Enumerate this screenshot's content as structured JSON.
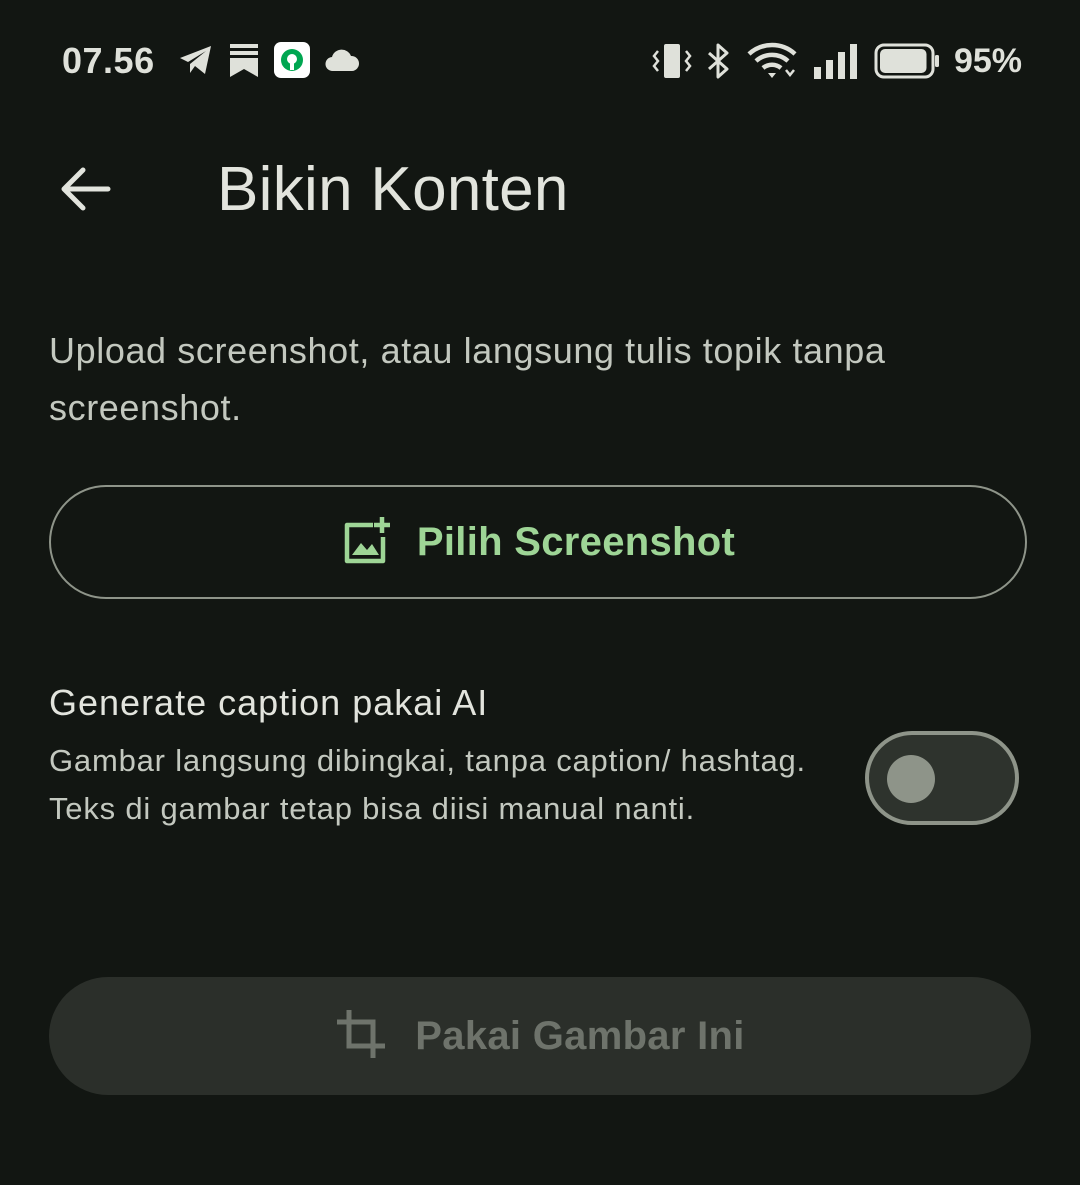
{
  "status_bar": {
    "time": "07.56",
    "battery_percent": "95%",
    "battery_level": 0.95,
    "left_icons": [
      "telegram-icon",
      "bookmark-stack-icon",
      "green-app-icon",
      "cloud-icon"
    ],
    "right_icons": [
      "vibrate-icon",
      "bluetooth-icon",
      "wifi-icon",
      "signal-icon",
      "battery-icon"
    ]
  },
  "app_bar": {
    "back_icon": "arrow-left-icon",
    "title": "Bikin Konten"
  },
  "intro_text": "Upload screenshot, atau langsung tulis topik tanpa screenshot.",
  "pick_screenshot_button": {
    "icon": "add-photo-icon",
    "label": "Pilih Screenshot"
  },
  "ai_caption": {
    "title": "Generate caption pakai AI",
    "description": "Gambar langsung dibingkai, tanpa caption/ hashtag. Teks di gambar tetap bisa diisi manual nanti.",
    "enabled": false
  },
  "use_image_button": {
    "icon": "crop-icon",
    "label": "Pakai Gambar Ini",
    "enabled": false
  },
  "colors": {
    "background": "#121612",
    "accent": "#9ed596",
    "outline": "#8e9489",
    "disabled_text": "#6e736b",
    "disabled_surface": "#2b2f2a"
  }
}
